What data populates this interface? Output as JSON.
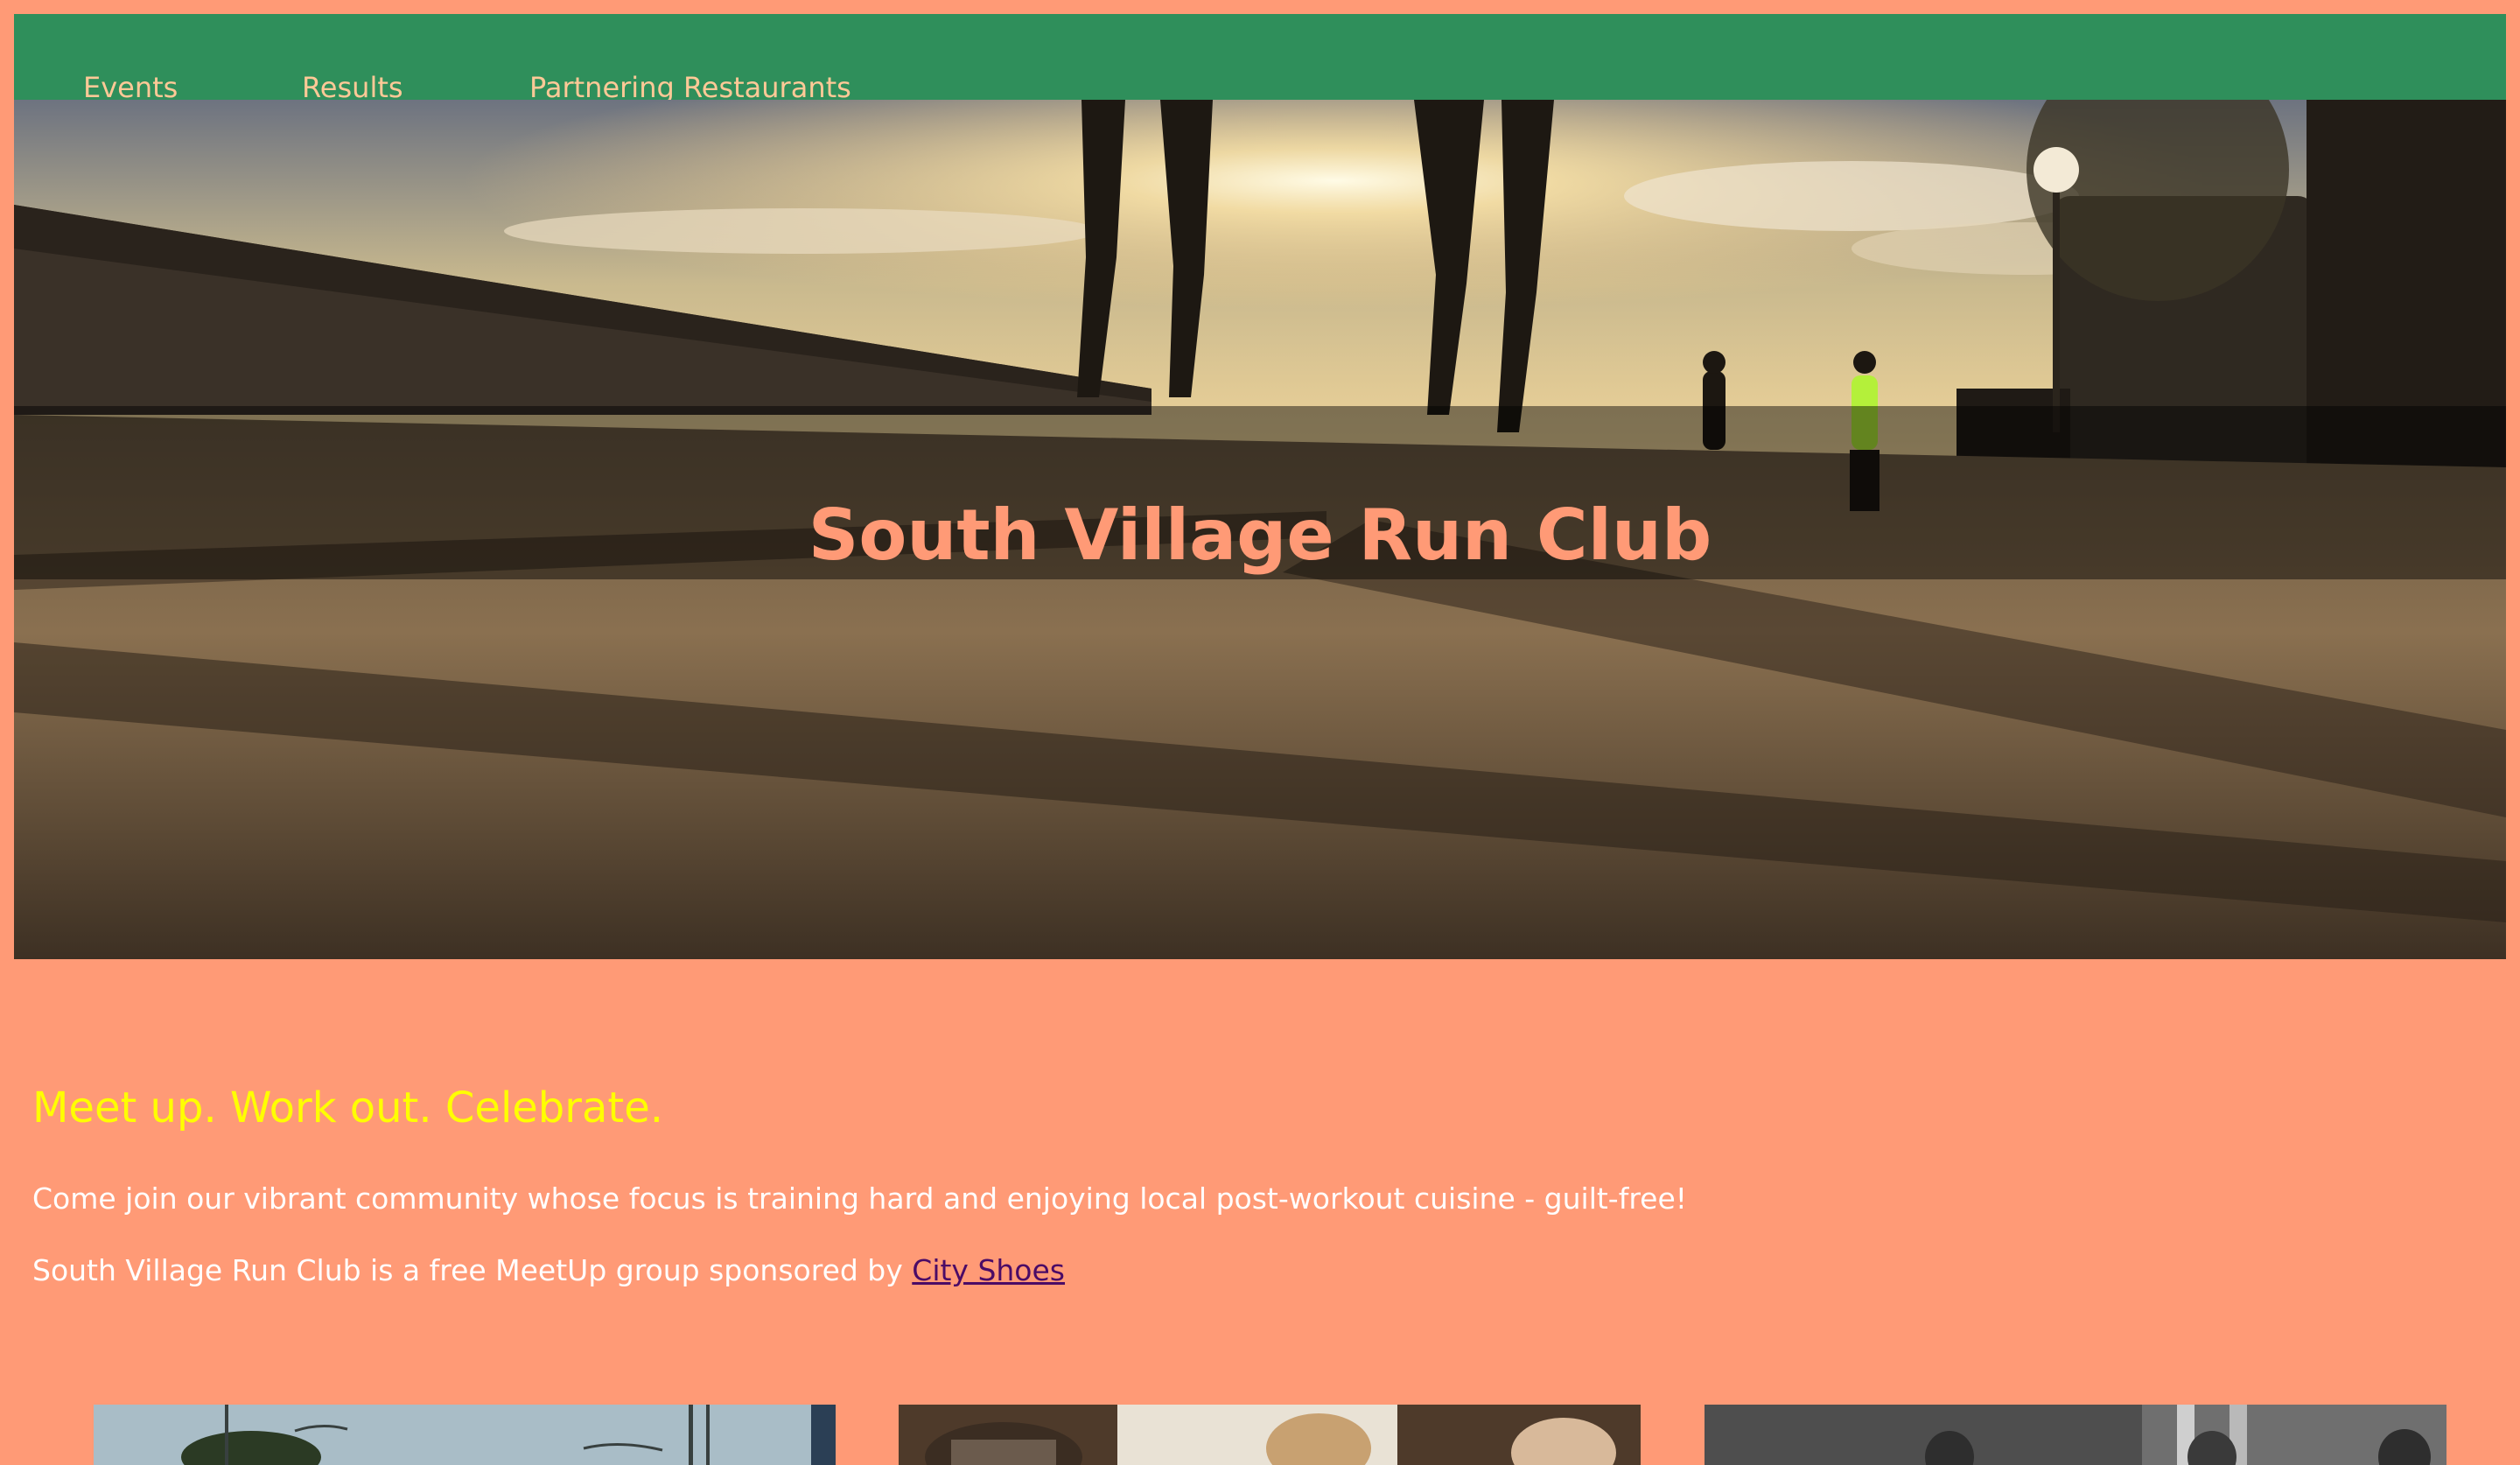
{
  "nav": {
    "items": [
      {
        "label": "Events"
      },
      {
        "label": "Results"
      },
      {
        "label": "Partnering Restaurants"
      }
    ]
  },
  "hero": {
    "title": "South Village Run Club",
    "image": "runners at sunset on pavement"
  },
  "main": {
    "tagline": "Meet up. Work out. Celebrate.",
    "paragraph1": "Come join our vibrant community whose focus is training hard and enjoying local post-workout cuisine - guilt-free!",
    "paragraph2_prefix": "South Village Run Club is a free MeetUp group sponsored by ",
    "sponsor_link": "City Shoes"
  },
  "cards": [
    {
      "image": "street scene photo"
    },
    {
      "image": "people at cafe photo"
    },
    {
      "image": "black and white group photo"
    }
  ],
  "colors": {
    "background": "#ff9a76",
    "nav_background": "#2f8f5b",
    "nav_text": "#ffc997",
    "tagline": "#ffff00",
    "body_text": "#ffffff",
    "link": "#4b0b66"
  }
}
